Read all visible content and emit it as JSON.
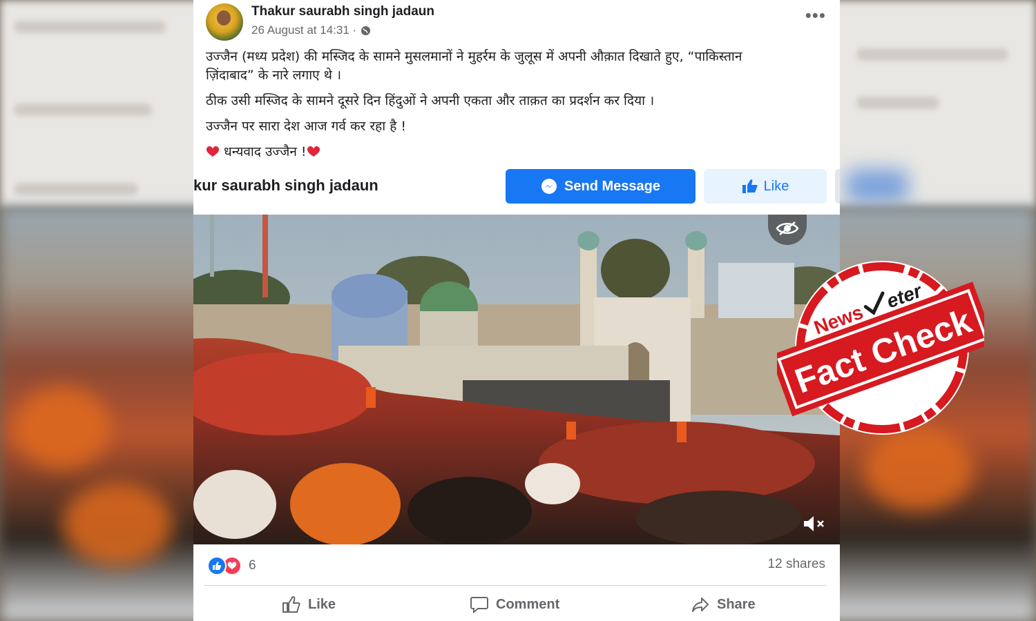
{
  "post": {
    "author": "Thakur saurabh singh jadaun",
    "timestamp": "26 August at 14:31 ·",
    "privacy_icon": "globe-icon",
    "more_label": "•••",
    "lines": [
      "उज्जैन (मध्य प्रदेश) की मस्जिद के सामने मुसलमानों ने मुहर्रम के जुलूस में अपनी औक़ात दिखाते हुए, “पाकिस्तान",
      "ज़िंदाबाद” के नारे लगाए थे ।",
      "ठीक उसी मस्जिद के सामने दूसरे  दिन हिंदुओं ने अपनी एकता और ताक़त का प्रदर्शन कर दिया ।",
      "उज्जैन पर सारा देश आज गर्व कर रहा है !",
      " धन्यवाद उज्जैन !"
    ]
  },
  "page_bar": {
    "name": "kur saurabh singh jadaun",
    "send_message_label": "Send Message",
    "like_label": "Like"
  },
  "engagement": {
    "reaction_count": "6",
    "shares": "12 shares"
  },
  "actions": {
    "like": "Like",
    "comment": "Comment",
    "share": "Share"
  },
  "stamp": {
    "brand_left": "News",
    "brand_right": "eter",
    "label": "Fact Check"
  },
  "colors": {
    "facebook_blue": "#1877f2",
    "stamp_red": "#d71920",
    "love_red": "#f33e58"
  }
}
